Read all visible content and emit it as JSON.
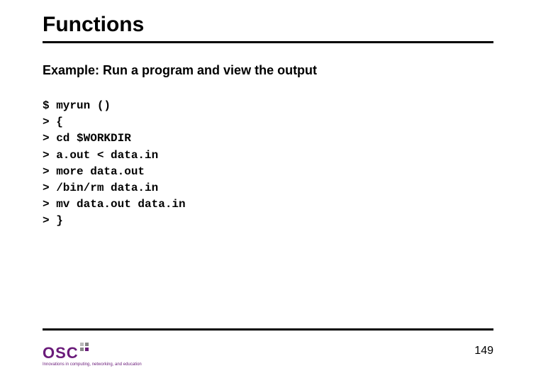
{
  "title": "Functions",
  "subtitle": "Example: Run a program and view the output",
  "code": "$ myrun ()\n> {\n> cd $WORKDIR\n> a.out < data.in\n> more data.out\n> /bin/rm data.in\n> mv data.out data.in\n> }",
  "logo": {
    "text": "OSC",
    "tagline": "Innovations in computing,\nnetworking, and education"
  },
  "page_number": "149"
}
